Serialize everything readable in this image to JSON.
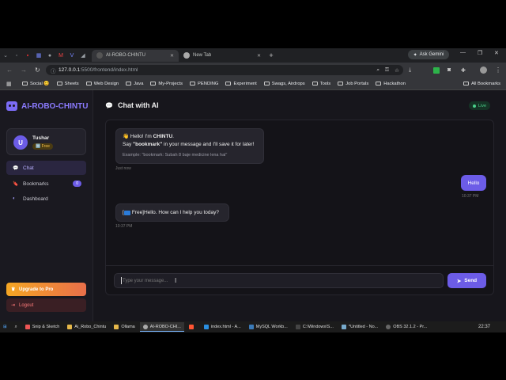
{
  "browser": {
    "tabs": [
      {
        "label": "AI-ROBO-CHINTU",
        "active": true
      },
      {
        "label": "New Tab",
        "active": false
      }
    ],
    "gemini_label": "Ask Gemini",
    "url_host": "127.0.0.1",
    "url_path": ":5500/frontend/index.html",
    "bookmarks": [
      "Social 😊",
      "Sheets",
      "Web Design",
      "Java",
      "My-Projects",
      "PENDING",
      "Experiment",
      "Swags, Airdrops",
      "Tools",
      "Job Portals",
      "Hackathon"
    ],
    "all_bookmarks": "All Bookmarks"
  },
  "sidebar": {
    "brand": "AI-ROBO-CHINTU",
    "user": {
      "initial": "U",
      "name": "Tushar",
      "plan": "🆓 Free"
    },
    "nav": [
      {
        "label": "Chat",
        "icon": "💬"
      },
      {
        "label": "Bookmarks",
        "icon": "🔖",
        "count": "0"
      },
      {
        "label": "Dashboard",
        "icon": "◐"
      }
    ],
    "upgrade": "Upgrade to Pro",
    "logout": "Logout"
  },
  "chat": {
    "title": "Chat with AI",
    "status": "Live",
    "welcome": {
      "line1_prefix": "👋 Hello! I'm ",
      "line1_name": "CHINTU",
      "line1_suffix": ".",
      "line2_prefix": "Say ",
      "line2_keyword": "\"bookmark\"",
      "line2_suffix": " in your message and I'll save it for later!",
      "example": "Example: \"bookmark: Subah 8 baje medicine lena hai\"",
      "time": "Just now"
    },
    "user_msg": {
      "text": "Hello",
      "time": "10:37 PM"
    },
    "bot_reply": {
      "prefix": "[",
      "tag": "Free]",
      "text": " Hello. How can I help you today?",
      "time": "10:37 PM"
    },
    "input_placeholder": "Type your message...",
    "send_label": "Send"
  },
  "taskbar": {
    "items": [
      "Snip & Sketch",
      "Ai_Robo_Chintu",
      "Ollama",
      "AI-ROBO-CHI...",
      "index.html - A...",
      "MySQL Workb...",
      "C:\\Windows\\S...",
      "*Untitled - No...",
      "OBS 32.1.2 - Pr..."
    ],
    "time": "22:37"
  },
  "colors": {
    "accent": "#6c5ce7",
    "live": "#4ad08a",
    "upgrade": "#f5a623",
    "logout": "#ff7b7b"
  }
}
